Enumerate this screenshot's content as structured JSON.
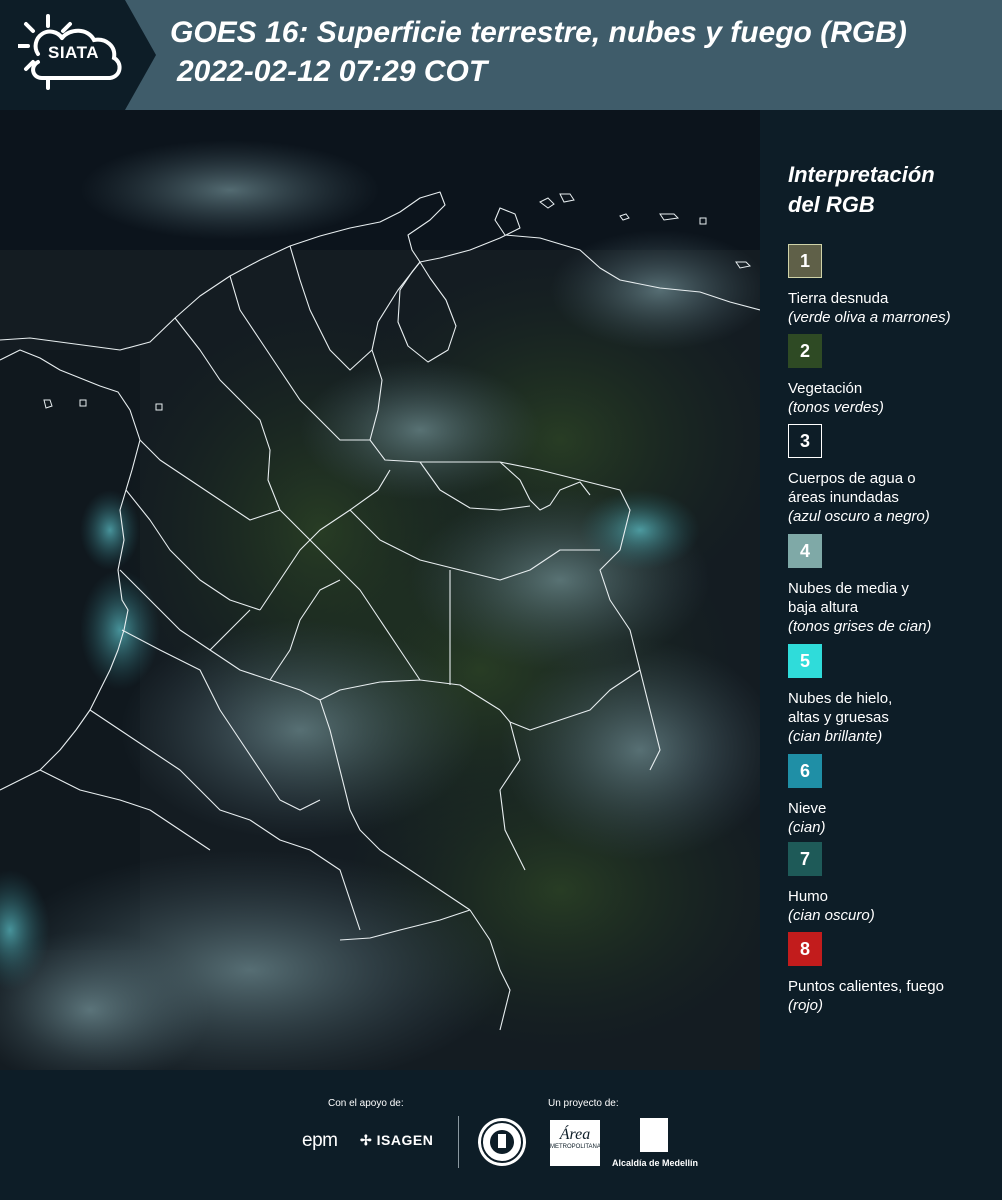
{
  "header": {
    "logo_text": "SIATA",
    "title": "GOES 16: Superficie terrestre, nubes y fuego (RGB)",
    "subtitle": "2022-02-12 07:29 COT"
  },
  "legend": {
    "title_line1": "Interpretación",
    "title_line2": "del RGB",
    "items": [
      {
        "number": "1",
        "color": "#5f6048",
        "label": "Tierra desnuda",
        "desc": "(verde oliva a marrones)"
      },
      {
        "number": "2",
        "color": "#2e4a24",
        "label": "Vegetación",
        "desc": "(tonos verdes)"
      },
      {
        "number": "3",
        "color": "#0d1d27",
        "label": "Cuerpos de agua o",
        "label2": "áreas inundadas",
        "desc": "(azul oscuro a negro)"
      },
      {
        "number": "4",
        "color": "#7fa9a7",
        "label": "Nubes de media y",
        "label2": "baja altura",
        "desc": "(tonos grises de cian)"
      },
      {
        "number": "5",
        "color": "#2fdcda",
        "label": "Nubes de hielo,",
        "label2": "altas y gruesas",
        "desc": "(cian brillante)"
      },
      {
        "number": "6",
        "color": "#1f8fa6",
        "label": "Nieve",
        "desc": "(cian)"
      },
      {
        "number": "7",
        "color": "#1e5a58",
        "label": "Humo",
        "desc": "(cian oscuro)"
      },
      {
        "number": "8",
        "color": "#c21c1c",
        "label": "Puntos calientes, fuego",
        "desc": "(rojo)"
      }
    ]
  },
  "footer": {
    "support_label": "Con el apoyo de:",
    "project_label": "Un proyecto de:",
    "sponsor1": "epm",
    "sponsor2": "ISAGEN",
    "partner_area": "Área",
    "partner_area_sub": "METROPOLITANA",
    "partner_medellin": "Alcaldía de Medellín"
  }
}
